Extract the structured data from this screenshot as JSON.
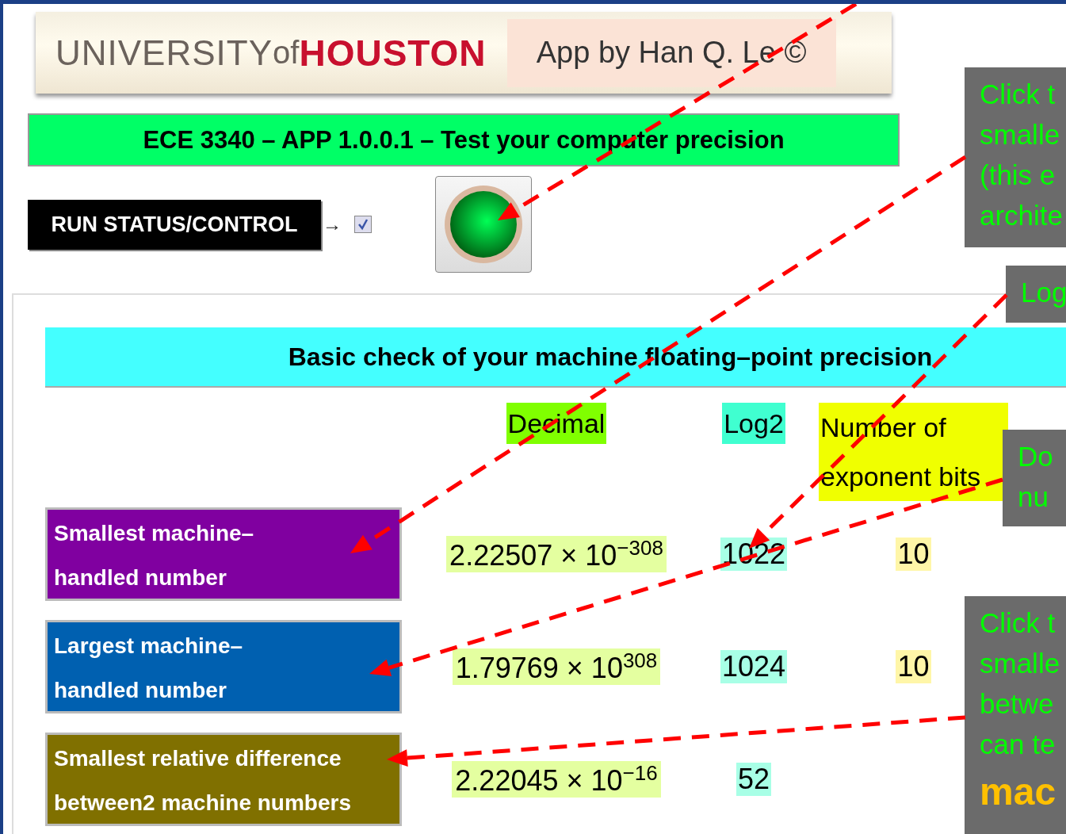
{
  "header": {
    "university": "UNIVERSITY",
    "of": "of",
    "houston": "HOUSTON",
    "credit": "App by Han Q. Le ©"
  },
  "title": "ECE 3340 – APP 1.0.0.1 – Test your computer precision",
  "run_control": {
    "label": "RUN STATUS/CONTROL",
    "arrow": "→",
    "checked": true,
    "light_on": true
  },
  "panel": {
    "heading": "Basic check of your machine floating–point precision",
    "columns": [
      {
        "label": "Decimal",
        "color": "#80ff00"
      },
      {
        "label": "Log2",
        "color": "#40ffd0"
      },
      {
        "label": "Number of exponent bits",
        "color": "#f0ff00"
      }
    ],
    "rows": [
      {
        "lines": [
          "Smallest machine–",
          "handled number"
        ],
        "color": "#8000a0",
        "decimal": "2.22507 × 10$^{−308}$",
        "log2": "1022",
        "exponent_bits": "10"
      },
      {
        "lines": [
          "Largest machine–",
          "handled number"
        ],
        "color": "#0060b0",
        "decimal": "1.79769 × 10$^{308}$",
        "log2": "1024",
        "exponent_bits": "10"
      },
      {
        "lines": [
          "Smallest relative difference",
          "between2 machine numbers"
        ],
        "color": "#807000",
        "decimal": "2.22045 × 10$^{−16}$",
        "log2": "52"
      }
    ]
  },
  "callouts": [
    {
      "lines": [
        {
          "kind": "normal",
          "text": "Click t"
        },
        {
          "kind": "normal",
          "text": "smalle"
        },
        {
          "kind": "normal",
          "text": "(this e"
        },
        {
          "kind": "normal",
          "text": "archite"
        }
      ]
    },
    {
      "lines": [
        {
          "kind": "normal",
          "text": "Log"
        }
      ]
    },
    {
      "lines": [
        {
          "kind": "normal",
          "text": "Do"
        },
        {
          "kind": "normal",
          "text": "nu"
        }
      ]
    },
    {
      "lines": [
        {
          "kind": "normal",
          "text": "Click t"
        },
        {
          "kind": "normal",
          "text": "smalle"
        },
        {
          "kind": "normal",
          "text": "betwe"
        },
        {
          "kind": "normal",
          "text": "can te"
        },
        {
          "kind": "emphasis",
          "text": "mac"
        }
      ]
    }
  ]
}
